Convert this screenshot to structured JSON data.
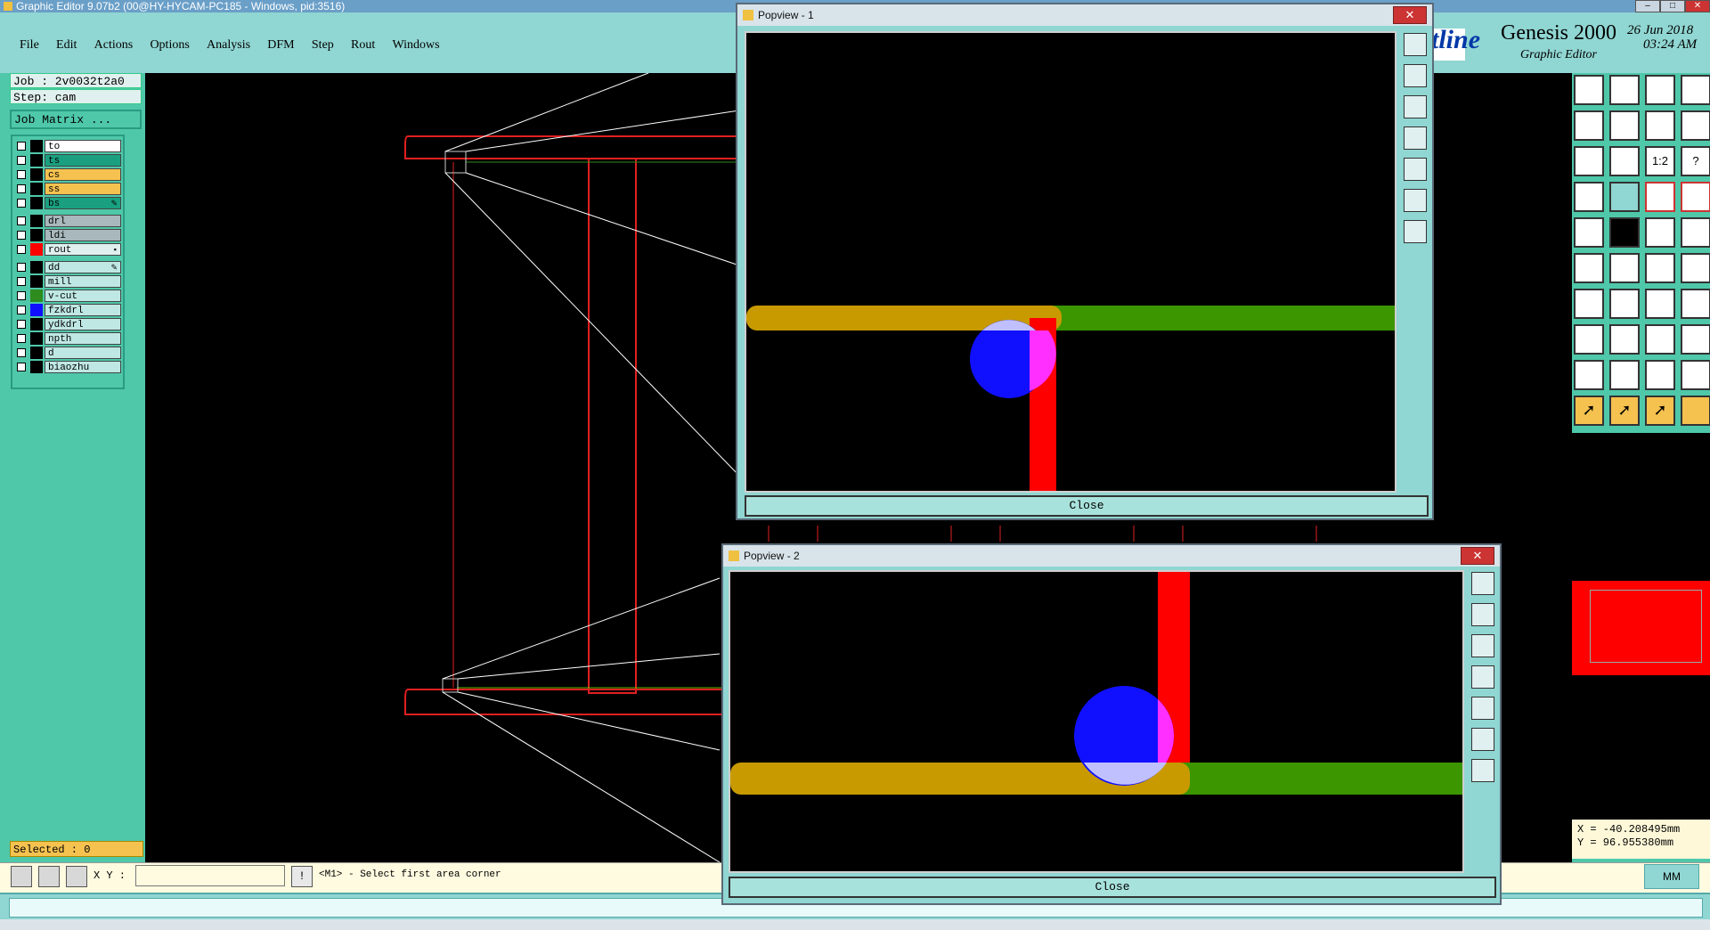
{
  "app": {
    "title": "Graphic Editor 9.07b2 (00@HY-HYCAM-PC185 - Windows, pid:3516)",
    "brand_partial": "tline",
    "product": "Genesis 2000",
    "subtitle": "Graphic Editor",
    "date": "26 Jun 2018",
    "time": "03:24 AM"
  },
  "menu": [
    "File",
    "Edit",
    "Actions",
    "Options",
    "Analysis",
    "DFM",
    "Step",
    "Rout",
    "Windows"
  ],
  "job": {
    "job_label": "Job : 2v0032t2a0",
    "step_label": "Step: cam",
    "matrix_button": "Job Matrix ..."
  },
  "layers": [
    {
      "name": "to",
      "color": "#ffffff",
      "swatch": "#000000",
      "mark": ""
    },
    {
      "name": "ts",
      "color": "#1aa080",
      "swatch": "#000000",
      "mark": ""
    },
    {
      "name": "cs",
      "color": "#f5c250",
      "swatch": "#000000",
      "mark": ""
    },
    {
      "name": "ss",
      "color": "#f5c250",
      "swatch": "#000000",
      "mark": ""
    },
    {
      "name": "bs",
      "color": "#1aa080",
      "swatch": "#000000",
      "mark": "✎"
    },
    {
      "name": "drl",
      "color": "#a8b8bc",
      "swatch": "#000000",
      "mark": ""
    },
    {
      "name": "ldi",
      "color": "#a8b8bc",
      "swatch": "#000000",
      "mark": ""
    },
    {
      "name": "rout",
      "color": "#dff0ef",
      "swatch": "#ff0000",
      "mark": "▪"
    },
    {
      "name": "dd",
      "color": "#bfe8e4",
      "swatch": "#000000",
      "mark": "✎"
    },
    {
      "name": "mill",
      "color": "#bfe8e4",
      "swatch": "#000000",
      "mark": ""
    },
    {
      "name": "v-cut",
      "color": "#bfe8e4",
      "swatch": "#2e8b1e",
      "mark": ""
    },
    {
      "name": "fzkdrl",
      "color": "#bfe8e4",
      "swatch": "#1010ff",
      "mark": ""
    },
    {
      "name": "ydkdrl",
      "color": "#bfe8e4",
      "swatch": "#000000",
      "mark": ""
    },
    {
      "name": "npth",
      "color": "#bfe8e4",
      "swatch": "#000000",
      "mark": ""
    },
    {
      "name": "d",
      "color": "#bfe8e4",
      "swatch": "#000000",
      "mark": ""
    },
    {
      "name": "biaozhu",
      "color": "#bfe8e4",
      "swatch": "#000000",
      "mark": ""
    }
  ],
  "selected_label": "Selected : 0",
  "input": {
    "xy_label": "X Y :",
    "xy_value": "",
    "info_button": "!",
    "prompt": "<M1> - Select first area corner"
  },
  "units": "MM",
  "coords": {
    "x_label": "X = -40.208495mm",
    "y_label": "Y = 96.955380mm"
  },
  "popview1": {
    "title": "Popview - 1",
    "close_label": "Close",
    "close_x": "✕"
  },
  "popview2": {
    "title": "Popview - 2",
    "close_label": "Close",
    "close_x": "✕"
  },
  "colors": {
    "panel": "#4fc8aa",
    "menubar": "#90d6d2",
    "highlight": "#f5c250",
    "rout": "#ff0000",
    "drill": "#1010ff",
    "vcut": "#2e8b1e",
    "copper": "#c89a00"
  }
}
